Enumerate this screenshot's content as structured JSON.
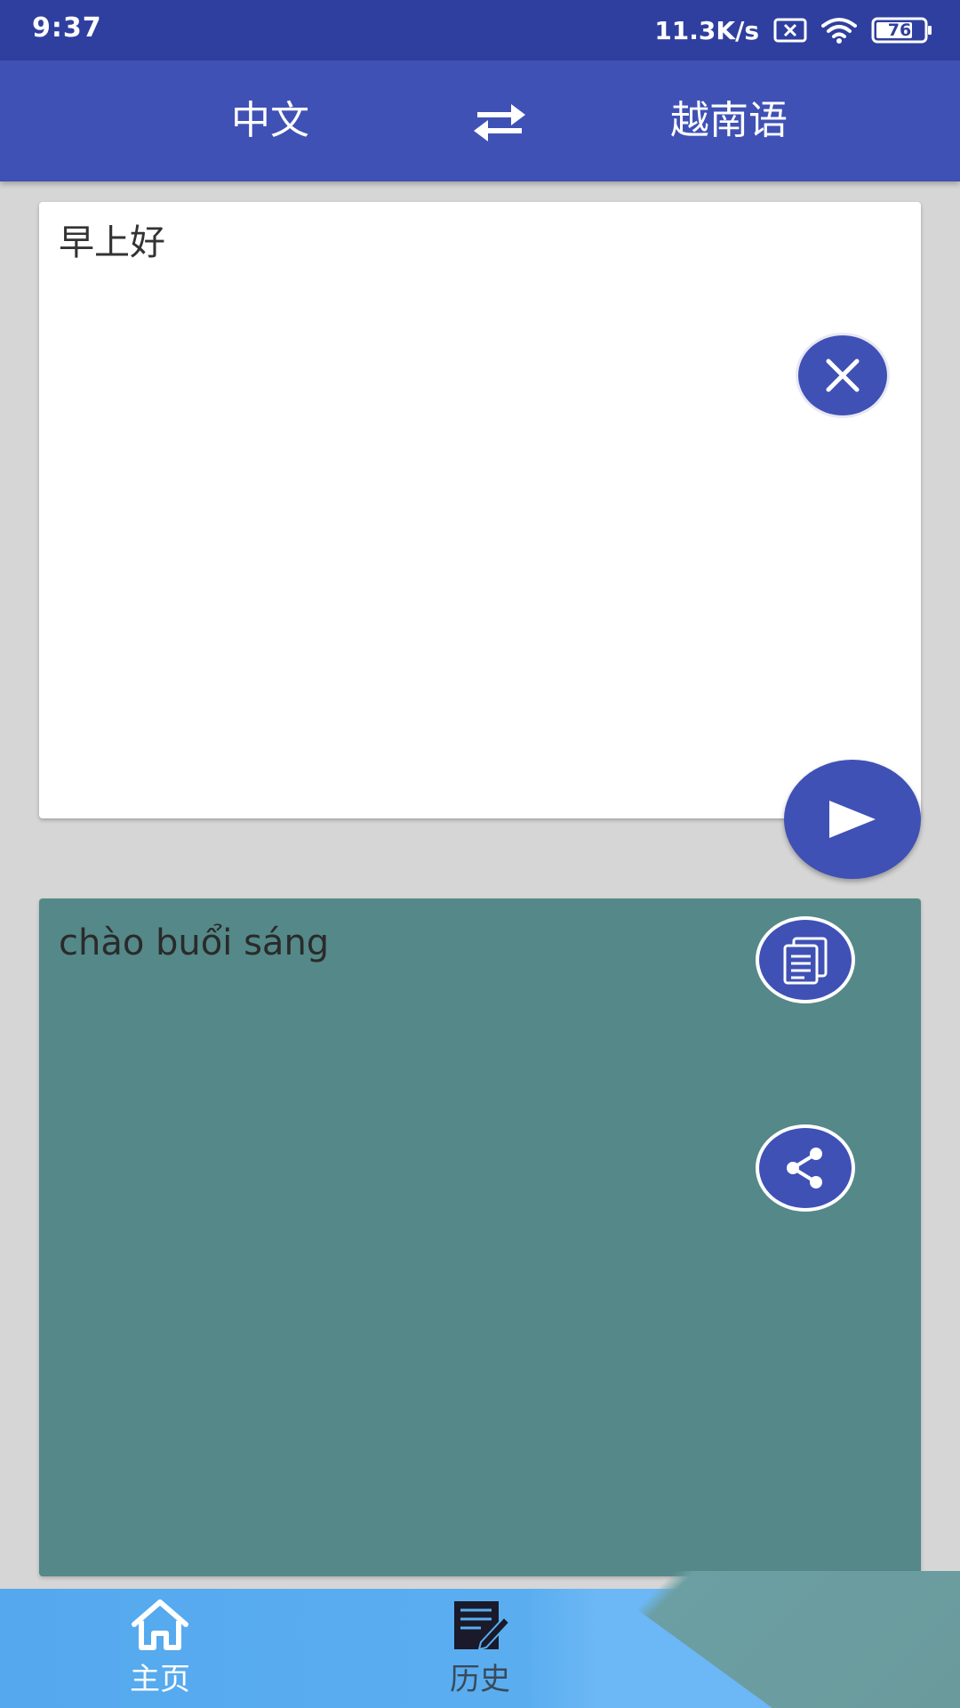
{
  "status_bar": {
    "time": "9:37",
    "net_speed": "11.3K/s",
    "battery": "76",
    "icons": [
      "no-sim-icon",
      "wifi-icon",
      "battery-icon"
    ]
  },
  "header": {
    "source_language": "中文",
    "target_language": "越南语",
    "swap_icon": "swap-arrows-icon"
  },
  "input": {
    "value": "早上好",
    "clear_icon": "close-icon",
    "translate_icon": "play-arrow-icon"
  },
  "output": {
    "text": "chào buổi sáng",
    "copy_icon": "copy-icon",
    "share_icon": "share-icon"
  },
  "bottom_nav": {
    "items": [
      {
        "label": "主页",
        "icon": "home-icon",
        "active": true
      },
      {
        "label": "历史",
        "icon": "history-icon",
        "active": false
      }
    ]
  },
  "colors": {
    "status_bar": "#2f3f9f",
    "primary": "#3f51b5",
    "output_background": "#558888",
    "bottom_nav": "#5aaef0",
    "page_background": "#d6d6d6"
  }
}
